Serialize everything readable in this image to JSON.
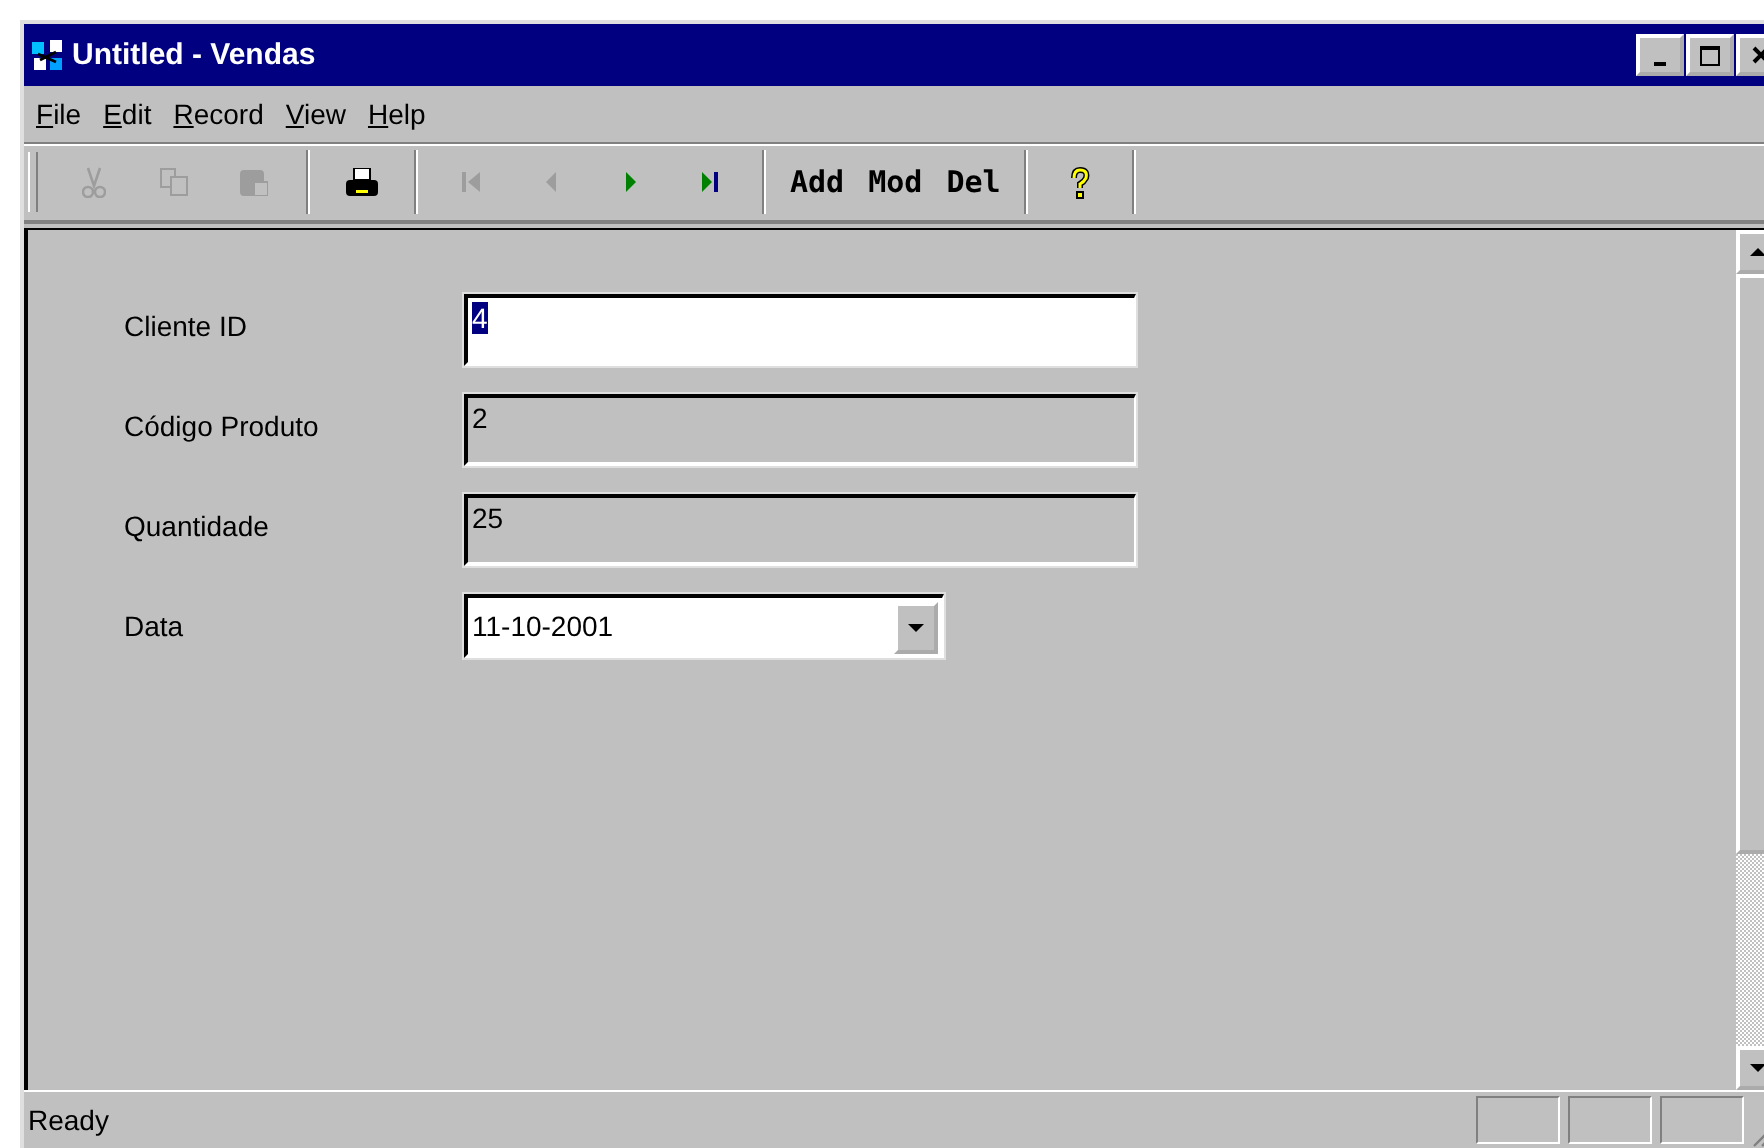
{
  "window": {
    "title": "Untitled - Vendas"
  },
  "menu": [
    {
      "label": "File"
    },
    {
      "label": "Edit"
    },
    {
      "label": "Record"
    },
    {
      "label": "View"
    },
    {
      "label": "Help"
    }
  ],
  "toolbar": [
    {
      "kind": "icon",
      "disabled": true
    },
    {
      "kind": "icon",
      "disabled": true
    },
    {
      "kind": "icon",
      "disabled": true
    },
    {
      "kind": "separator"
    },
    {
      "kind": "icon",
      "disabled": false
    },
    {
      "kind": "separator"
    },
    {
      "kind": "icon",
      "disabled": true
    },
    {
      "kind": "icon",
      "disabled": true
    },
    {
      "kind": "icon",
      "disabled": false
    },
    {
      "kind": "icon",
      "disabled": false
    },
    {
      "kind": "separator"
    },
    {
      "kind": "text",
      "label": "Add"
    },
    {
      "kind": "text",
      "label": "Mod"
    },
    {
      "kind": "text",
      "label": "Del"
    },
    {
      "kind": "separator"
    },
    {
      "kind": "icon",
      "disabled": false
    },
    {
      "kind": "separator"
    }
  ],
  "form": [
    {
      "label": "Cliente ID",
      "kind": "text",
      "value": "4",
      "disabled": false,
      "selected": true
    },
    {
      "label": "Código Produto",
      "kind": "text",
      "value": "2",
      "disabled": true,
      "selected": false
    },
    {
      "label": "Quantidade",
      "kind": "text",
      "value": "25",
      "disabled": true,
      "selected": false
    },
    {
      "label": "Data",
      "kind": "dropdown",
      "value": "11-10-2001",
      "disabled": false,
      "selected": false
    }
  ],
  "status_bar": {
    "text": "Ready"
  }
}
